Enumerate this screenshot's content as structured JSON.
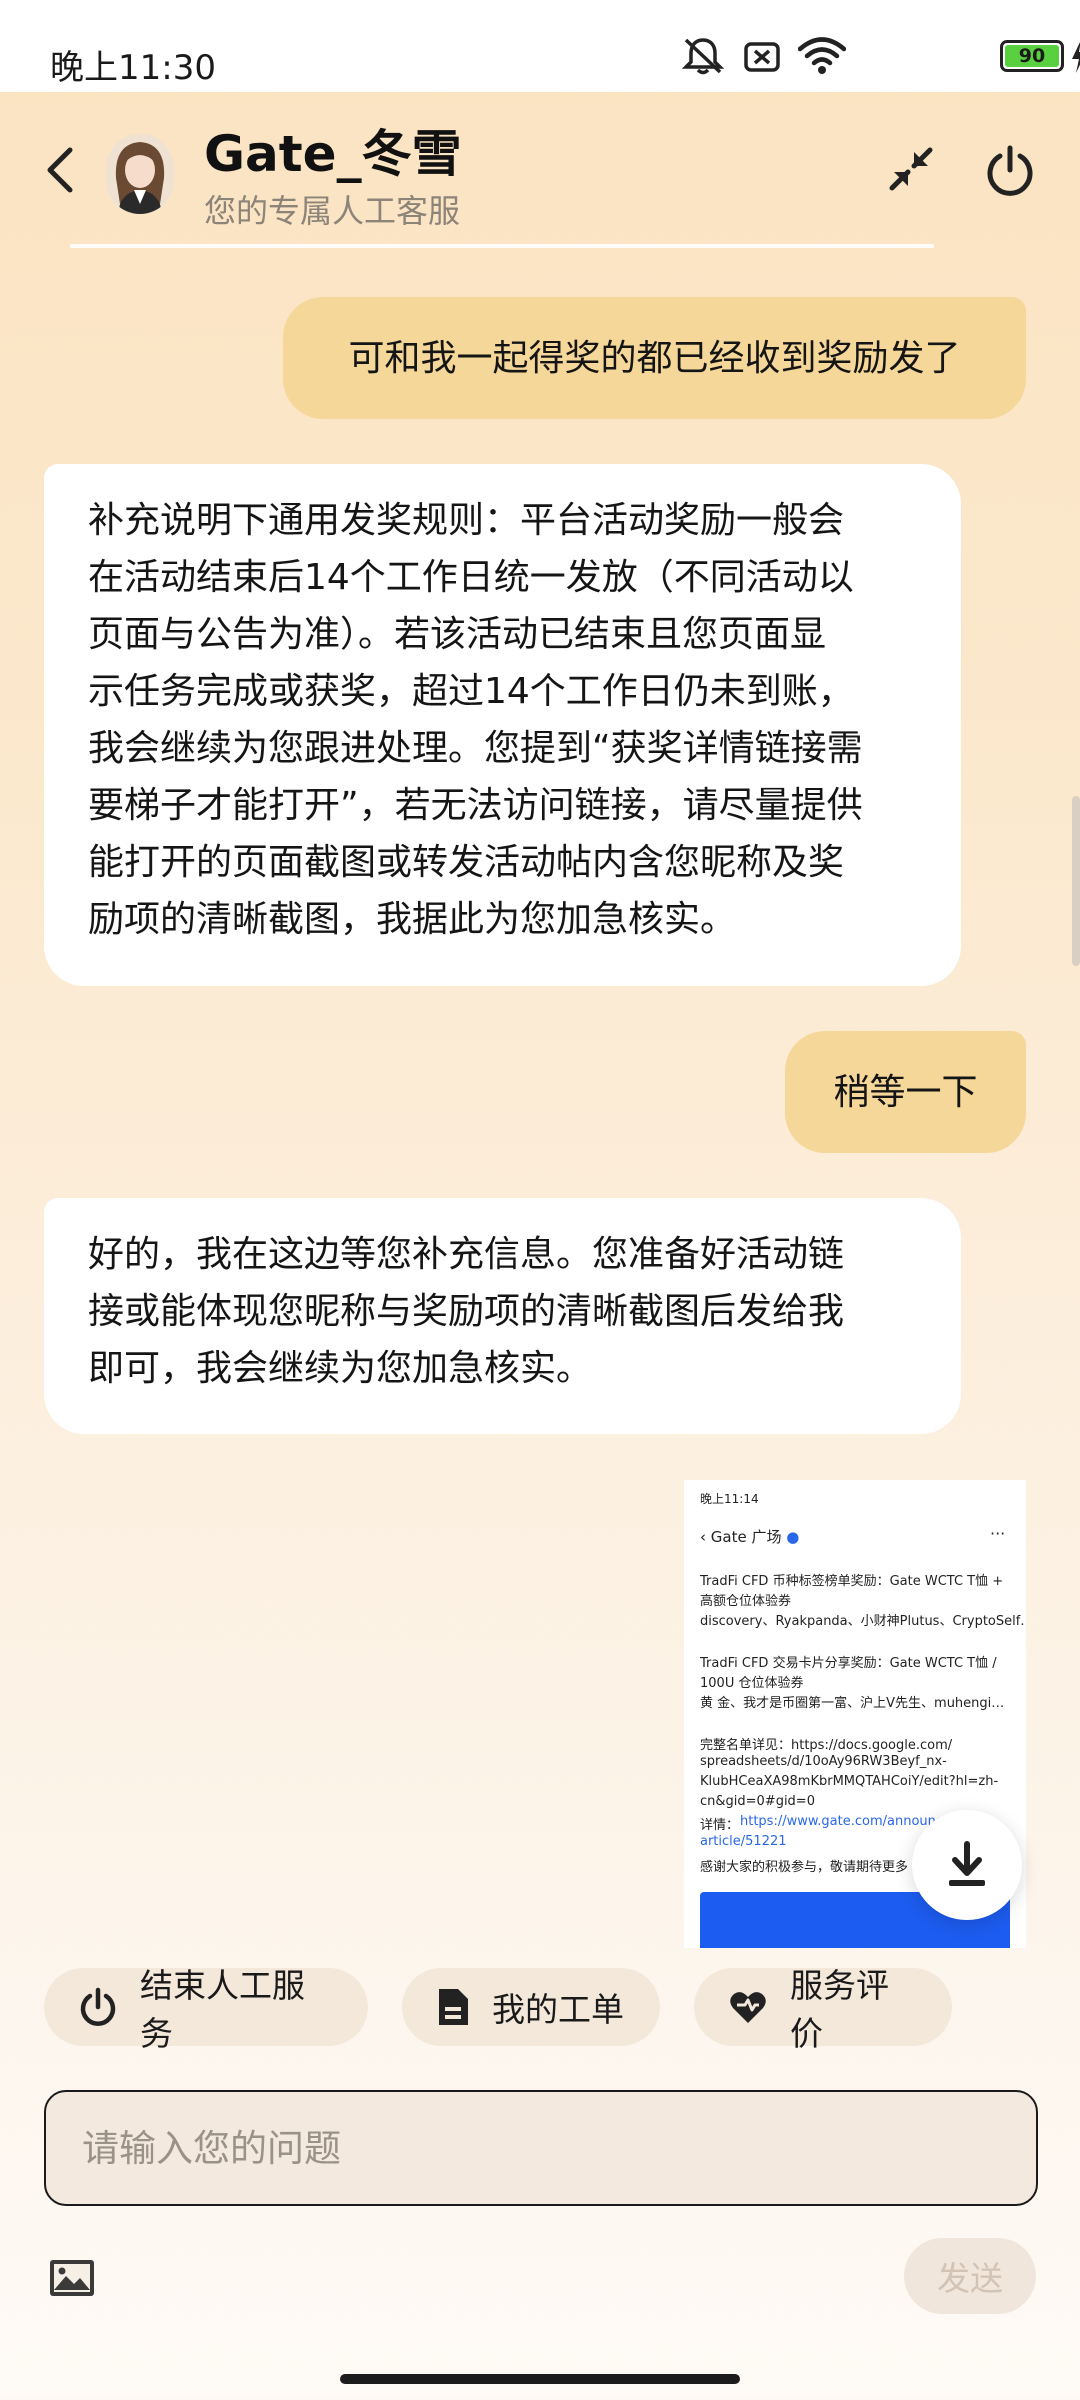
{
  "status_bar": {
    "time": "晚上11:30",
    "battery": "90",
    "icons": [
      "mute-icon",
      "no-sim-icon",
      "wifi-icon",
      "battery-icon",
      "charging-icon"
    ]
  },
  "header": {
    "agent_name": "Gate_冬雪",
    "agent_subtitle": "您的专属人工客服",
    "icons": [
      "back-icon",
      "collapse-icon",
      "power-icon"
    ]
  },
  "messages": [
    {
      "role": "user",
      "text": "可和我一起得奖的都已经收到奖励发了"
    },
    {
      "role": "agent",
      "lines": [
        "补充说明下通用发奖规则：平台活动奖励一般会",
        "在活动结束后14个工作日统一发放（不同活动以",
        "页面与公告为准）。若该活动已结束且您页面显",
        "示任务完成或获奖，超过14个工作日仍未到账，",
        "我会继续为您跟进处理。您提到“获奖详情链接需",
        "要梯子才能打开”，若无法访问链接，请尽量提供",
        "能打开的页面截图或转发活动帖内含您昵称及奖",
        "励项的清晰截图，我据此为您加急核实。"
      ]
    },
    {
      "role": "user",
      "text": "稍等一下"
    },
    {
      "role": "agent",
      "lines": [
        "好的，我在这边等您补充信息。您准备好活动链",
        "接或能体现您昵称与奖励项的清晰截图后发给我",
        "即可，我会继续为您加急核实。"
      ]
    }
  ],
  "image_message": {
    "status_time": "晚上11:14",
    "title": "Gate 广场",
    "menu": "···",
    "lines": [
      "TradFi CFD 币种标签榜单奖励：Gate WCTC T恤 +",
      "高额仓位体验券",
      "discovery、Ryakpanda、小财神Plutus、CryptoSelf…",
      "TradFi CFD 交易卡片分享奖励：Gate WCTC T恤 /",
      "100U 仓位体验券",
      "黄 金、我才是币圈第一富、沪上V先生、muhengi…",
      "完整名单详见：https://docs.google.com/",
      "spreadsheets/d/10oAy96RW3Beyf_nx-",
      "KlubHCeaXA98mKbrMMQTAHCoiY/edit?hl=zh-",
      "cn&gid=0#gid=0",
      "详情：",
      "https://www.gate.com/announc",
      "article/51221",
      "感谢大家的积极参与，敬请期待更多"
    ]
  },
  "quick_actions": [
    {
      "label": "结束人工服务",
      "icon": "power-icon"
    },
    {
      "label": "我的工单",
      "icon": "document-icon"
    },
    {
      "label": "服务评价",
      "icon": "heart-rating-icon"
    }
  ],
  "composer": {
    "placeholder": "请输入您的问题",
    "send_label": "发送",
    "icons": [
      "image-icon",
      "download-icon"
    ]
  },
  "colors": {
    "user_bubble": "#f6d79a",
    "agent_bubble": "#ffffff",
    "background_top": "#fbe3c1"
  }
}
